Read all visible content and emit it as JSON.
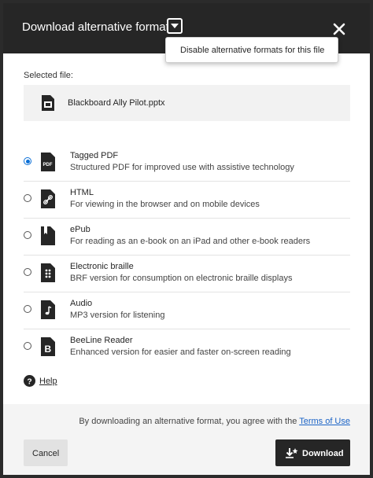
{
  "dialog": {
    "title": "Download alternative formats",
    "dropdown_item": "Disable alternative formats for this file",
    "selected_file_label": "Selected file:",
    "file_name": "Blackboard Ally Pilot.pptx"
  },
  "formats": [
    {
      "title": "Tagged PDF",
      "description": "Structured PDF for improved use with assistive technology",
      "selected": true,
      "icon": "pdf-icon"
    },
    {
      "title": "HTML",
      "description": "For viewing in the browser and on mobile devices",
      "selected": false,
      "icon": "html-link-icon"
    },
    {
      "title": "ePub",
      "description": "For reading as an e-book on an iPad and other e-book readers",
      "selected": false,
      "icon": "epub-bookmark-icon"
    },
    {
      "title": "Electronic braille",
      "description": "BRF version for consumption on electronic braille displays",
      "selected": false,
      "icon": "braille-icon"
    },
    {
      "title": "Audio",
      "description": "MP3 version for listening",
      "selected": false,
      "icon": "audio-note-icon"
    },
    {
      "title": "BeeLine Reader",
      "description": "Enhanced version for easier and faster on-screen reading",
      "selected": false,
      "icon": "beeline-icon"
    }
  ],
  "help_label": "Help",
  "footer": {
    "terms_text": "By downloading an alternative format, you agree with the",
    "terms_link": "Terms of Use",
    "cancel_label": "Cancel",
    "download_label": "Download"
  },
  "colors": {
    "header": "#262626",
    "accent": "#0a6fd6",
    "link": "#1b63c6"
  }
}
